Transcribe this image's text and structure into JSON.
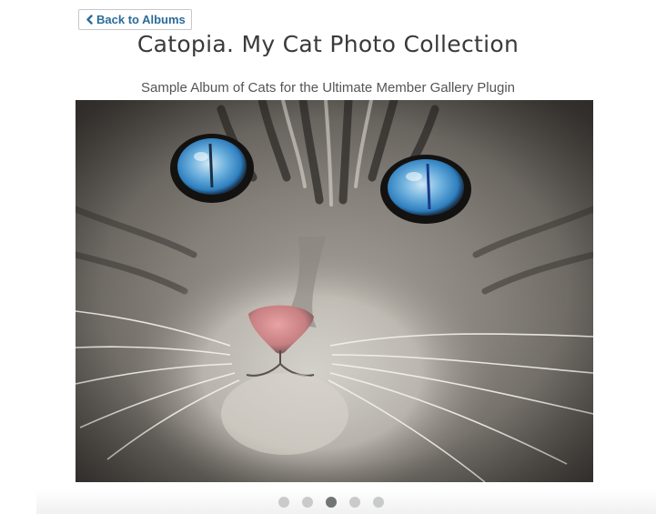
{
  "back_button": {
    "label": "Back to Albums",
    "icon": "chevron-left-icon"
  },
  "album": {
    "title": "Catopia. My Cat Photo Collection",
    "description": "Sample Album of Cats for the Ultimate Member Gallery Plugin"
  },
  "carousel": {
    "total_slides": 5,
    "active_slide": 3
  },
  "colors": {
    "link_blue": "#2a6c9a",
    "title_text": "#3a3a3a",
    "dot_inactive": "#c9cbcb",
    "dot_active": "#717575"
  }
}
